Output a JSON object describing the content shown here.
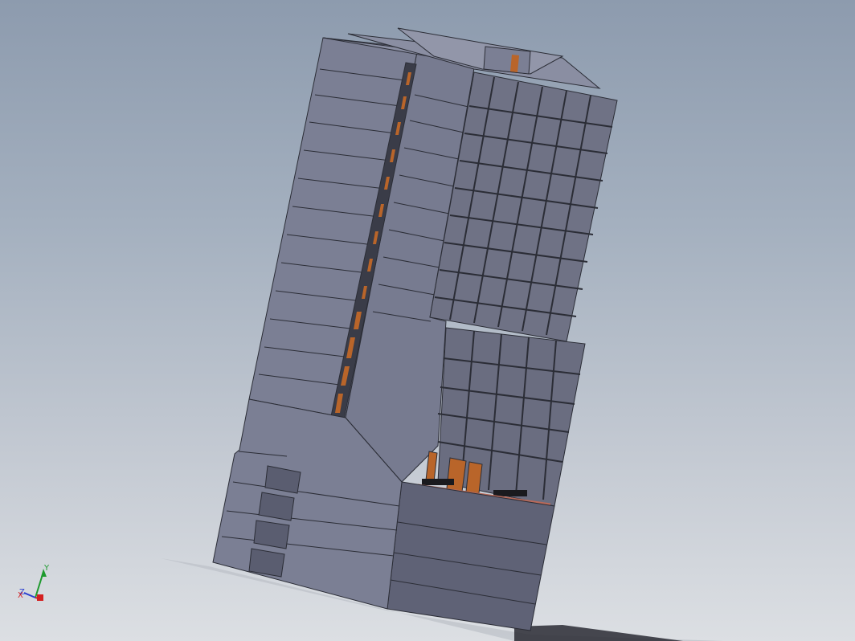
{
  "viewport": {
    "background_top": "#8d9bae",
    "background_bottom": "#dcdfe3"
  },
  "model": {
    "wall_color": "#7b7f94",
    "wall_dark": "#5f6276",
    "window_color": "#6b6e80",
    "accent_color": "#b9652a"
  },
  "triad": {
    "x_label": "X",
    "y_label": "Y",
    "z_label": "Z",
    "x_color": "#d42020",
    "y_color": "#1e9a2e",
    "z_color": "#2a3fd0"
  }
}
